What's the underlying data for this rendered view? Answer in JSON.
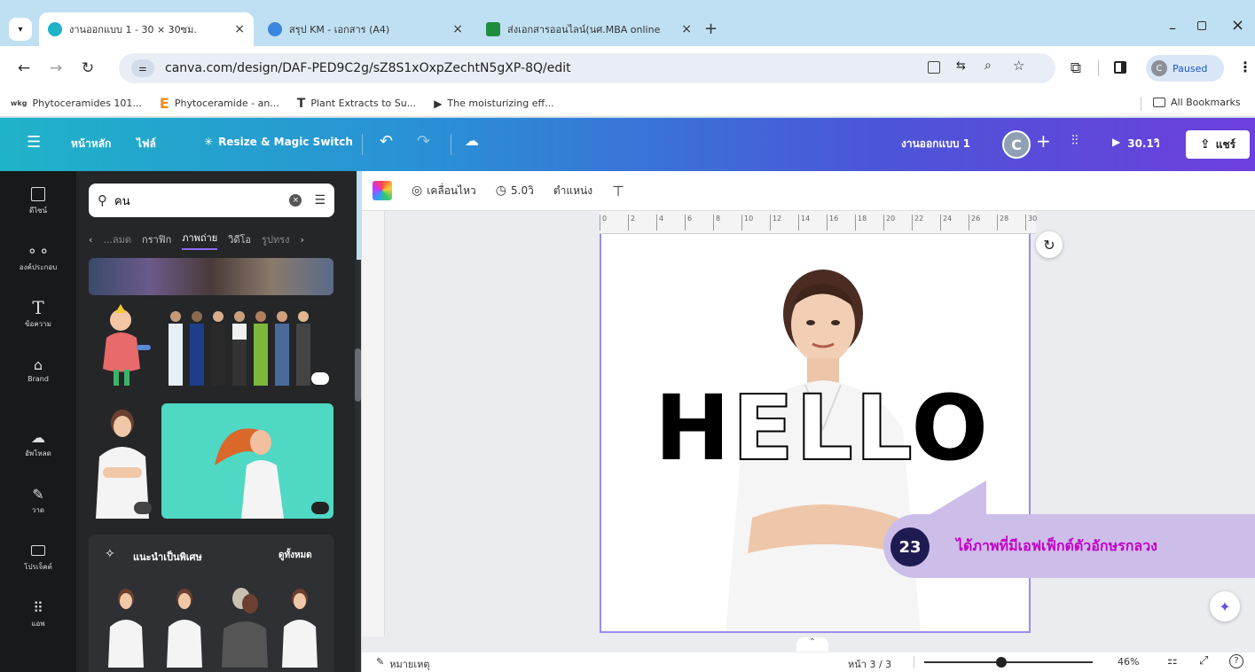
{
  "browser": {
    "tabs": [
      {
        "title": "งานออกแบบ 1 - 30 × 30ซม.",
        "active": true
      },
      {
        "title": "สรุป KM - เอกสาร (A4)",
        "active": false
      },
      {
        "title": "ส่งเอกสารออนไลน์(นศ.MBA online",
        "active": false
      }
    ],
    "new_tab": "+",
    "url": "canva.com/design/DAF-PED9C2g/sZ8S1xOxpZechtN5gXP-8Q/edit",
    "profile_status": "Paused",
    "profile_initial": "C",
    "bookmarks": [
      {
        "label": "Phytoceramides 101...",
        "icon": "wkg"
      },
      {
        "label": "Phytoceramide - an...",
        "icon": "E"
      },
      {
        "label": "Plant Extracts to Su...",
        "icon": "T"
      },
      {
        "label": "The moisturizing eff...",
        "icon": "play-icon"
      }
    ],
    "all_bookmarks": "All Bookmarks"
  },
  "header": {
    "home": "หน้าหลัก",
    "file": "ไฟล์",
    "resize": "Resize & Magic Switch",
    "doc_title": "งานออกแบบ 1",
    "avatar_initial": "C",
    "present_label": "30.1วิ",
    "share_label": "แชร์"
  },
  "rail": [
    {
      "label": "ดีไซน์",
      "icon": "layout-icon"
    },
    {
      "label": "องค์ประกอบ",
      "icon": "shapes-icon"
    },
    {
      "label": "ข้อความ",
      "icon": "text-icon"
    },
    {
      "label": "Brand",
      "icon": "brand-icon"
    },
    {
      "label": "อัพโหลด",
      "icon": "upload-icon"
    },
    {
      "label": "วาด",
      "icon": "draw-icon"
    },
    {
      "label": "โปรเจ็คต์",
      "icon": "folder-icon"
    },
    {
      "label": "แอพ",
      "icon": "apps-icon"
    }
  ],
  "panel": {
    "search_value": "คน",
    "categories": [
      "...ลมด",
      "กราฟิก",
      "ภาพถ่าย",
      "วิดีโอ",
      "รูปทรง"
    ],
    "active_category": "ภาพถ่าย",
    "recommend_title": "แนะนำเป็นพิเศษ",
    "see_all": "ดูทั้งหมด"
  },
  "context_bar": {
    "animate": "เคลื่อนไหว",
    "duration": "5.0วิ",
    "position": "ตำแหน่ง"
  },
  "ruler_ticks": [
    "0",
    "2",
    "4",
    "6",
    "8",
    "10",
    "12",
    "14",
    "16",
    "18",
    "20",
    "22",
    "24",
    "26",
    "28",
    "30"
  ],
  "canvas": {
    "hello_filled_start": "H",
    "hello_outline": "ELL",
    "hello_filled_end": "O"
  },
  "callout": {
    "number": "23",
    "text": "ได้ภาพที่มีเอฟเฟ็กต์ตัวอักษรกลวง"
  },
  "status": {
    "notes": "หมายเหตุ",
    "page": "หน้า 3 / 3",
    "zoom": "46%",
    "zoom_level": 0.46
  }
}
